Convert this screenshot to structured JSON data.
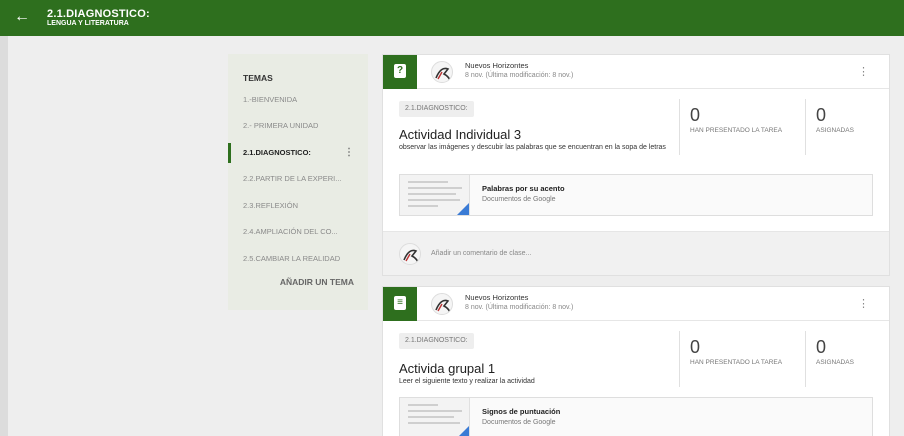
{
  "header": {
    "title": "2.1.DIAGNOSTICO:",
    "subtitle": "LENGUA Y LITERATURA",
    "back_icon": "arrow-left-icon"
  },
  "sidebar": {
    "heading": "TEMAS",
    "items": [
      {
        "label": "1.-BIENVENIDA"
      },
      {
        "label": "2.- PRIMERA UNIDAD"
      },
      {
        "label": "2.1.DIAGNOSTICO:",
        "active": true
      },
      {
        "label": "2.2.PARTIR DE LA EXPERI..."
      },
      {
        "label": "2.3.REFLEXIÓN"
      },
      {
        "label": "2.4.AMPLIACIÓN DEL CO..."
      },
      {
        "label": "2.5.CAMBIAR LA REALIDAD"
      }
    ],
    "add_topic": "AÑADIR UN TEMA"
  },
  "posts": [
    {
      "type_icon": "question-icon",
      "author": "Nuevos Horizontes",
      "date": "8 nov. (Última modificación: 8 nov.)",
      "topic_chip": "2.1.DIAGNOSTICO:",
      "title": "Actividad Individual 3",
      "description": "observar las imágenes y descubir las palabras que se encuentran en la sopa de letras",
      "stats": [
        {
          "value": "0",
          "label": "HAN PRESENTADO LA TAREA"
        },
        {
          "value": "0",
          "label": "ASIGNADAS"
        }
      ],
      "attachment": {
        "title": "Palabras por su acento",
        "subtitle": "Documentos de Google"
      },
      "comment_placeholder": "Añadir un comentario de clase..."
    },
    {
      "type_icon": "assignment-icon",
      "author": "Nuevos Horizontes",
      "date": "8 nov. (Última modificación: 8 nov.)",
      "topic_chip": "2.1.DIAGNOSTICO:",
      "title": "Activida grupal 1",
      "description": "Leer el siguiente texto y realizar la actividad",
      "stats": [
        {
          "value": "0",
          "label": "HAN PRESENTADO LA TAREA"
        },
        {
          "value": "0",
          "label": "ASIGNADAS"
        }
      ],
      "attachment": {
        "title": "Signos de puntuación",
        "subtitle": "Documentos de Google"
      }
    }
  ],
  "colors": {
    "primary": "#2e6f1e",
    "background": "#eeeeee",
    "doc_corner": "#3a7bd5"
  }
}
